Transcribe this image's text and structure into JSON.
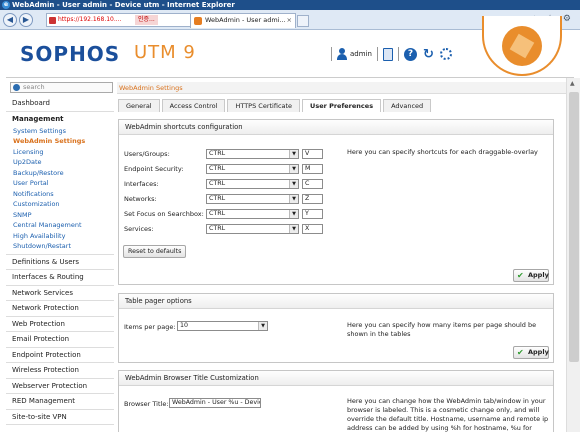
{
  "window": {
    "title": "WebAdmin - User admin - Device utm - Internet Explorer"
  },
  "browser": {
    "url": "https://192.168.10....",
    "cert_error": "인증...",
    "tab_title": "WebAdmin - User admi...",
    "tools": "⌂ ☆ ⚙"
  },
  "header": {
    "logo": "SOPHOS",
    "product": "UTM 9",
    "user": "admin"
  },
  "search": {
    "placeholder": "search"
  },
  "breadcrumb": "WebAdmin Settings",
  "sidebar": {
    "top": "Dashboard",
    "management": {
      "label": "Management",
      "items": [
        "System Settings",
        "WebAdmin Settings",
        "Licensing",
        "Up2Date",
        "Backup/Restore",
        "User Portal",
        "Notifications",
        "Customization",
        "SNMP",
        "Central Management",
        "High Availability",
        "Shutdown/Restart"
      ],
      "active_index": 1
    },
    "sections": [
      "Definitions & Users",
      "Interfaces & Routing",
      "Network Services",
      "Network Protection",
      "Web Protection",
      "Email Protection",
      "Endpoint Protection",
      "Wireless Protection",
      "Webserver Protection",
      "RED Management",
      "Site-to-site VPN"
    ]
  },
  "tabs": [
    "General",
    "Access Control",
    "HTTPS Certificate",
    "User Preferences",
    "Advanced"
  ],
  "shortcuts": {
    "title": "WebAdmin shortcuts configuration",
    "description": "Here you can specify shortcuts for each draggable-overlay",
    "rows": [
      {
        "label": "Users/Groups:",
        "modifier": "CTRL",
        "key": "V"
      },
      {
        "label": "Endpoint Security:",
        "modifier": "CTRL",
        "key": "M"
      },
      {
        "label": "Interfaces:",
        "modifier": "CTRL",
        "key": "C"
      },
      {
        "label": "Networks:",
        "modifier": "CTRL",
        "key": "Z"
      },
      {
        "label": "Set Focus on Searchbox:",
        "modifier": "CTRL",
        "key": "Y"
      },
      {
        "label": "Services:",
        "modifier": "CTRL",
        "key": "X"
      }
    ],
    "reset_label": "Reset to defaults",
    "apply_label": "Apply"
  },
  "pager": {
    "title": "Table pager options",
    "label": "Items per page:",
    "value": "10",
    "description": "Here you can specify how many items per page should be shown in the tables",
    "apply_label": "Apply"
  },
  "browser_title": {
    "title": "WebAdmin Browser Title Customization",
    "label": "Browser Title:",
    "value": "WebAdmin - User %u - Devic",
    "description": "Here you can change how the WebAdmin tab/window in your browser is labeled. This is a cosmetic change only, and will override the default title. Hostname, username and remote ip address can be added by using %h for hostname, %u for"
  },
  "colors": {
    "brand_blue": "#1b4f9b",
    "brand_orange": "#e98d2c",
    "link_blue": "#1b5fae",
    "active_orange": "#d9711c"
  }
}
